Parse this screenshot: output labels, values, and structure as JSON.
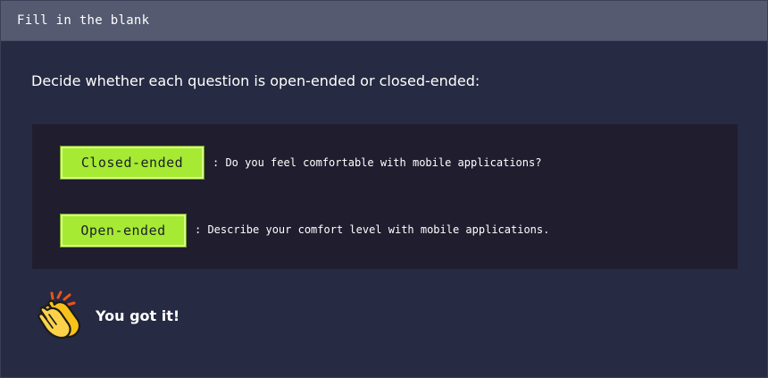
{
  "header": {
    "title": "Fill in the blank"
  },
  "prompt": "Decide whether each question is open-ended or closed-ended:",
  "questions": [
    {
      "answer": "Closed-ended",
      "text": ": Do you feel comfortable with mobile applications?"
    },
    {
      "answer": "Open-ended",
      "text": ": Describe your comfort level with mobile applications."
    }
  ],
  "feedback": {
    "icon": "clapping-hands-icon",
    "text": "You got it!"
  },
  "colors": {
    "background": "#262a42",
    "header": "#555a70",
    "panel": "#201d2f",
    "answer_fill": "#a6ea33",
    "text": "#ffffff"
  }
}
